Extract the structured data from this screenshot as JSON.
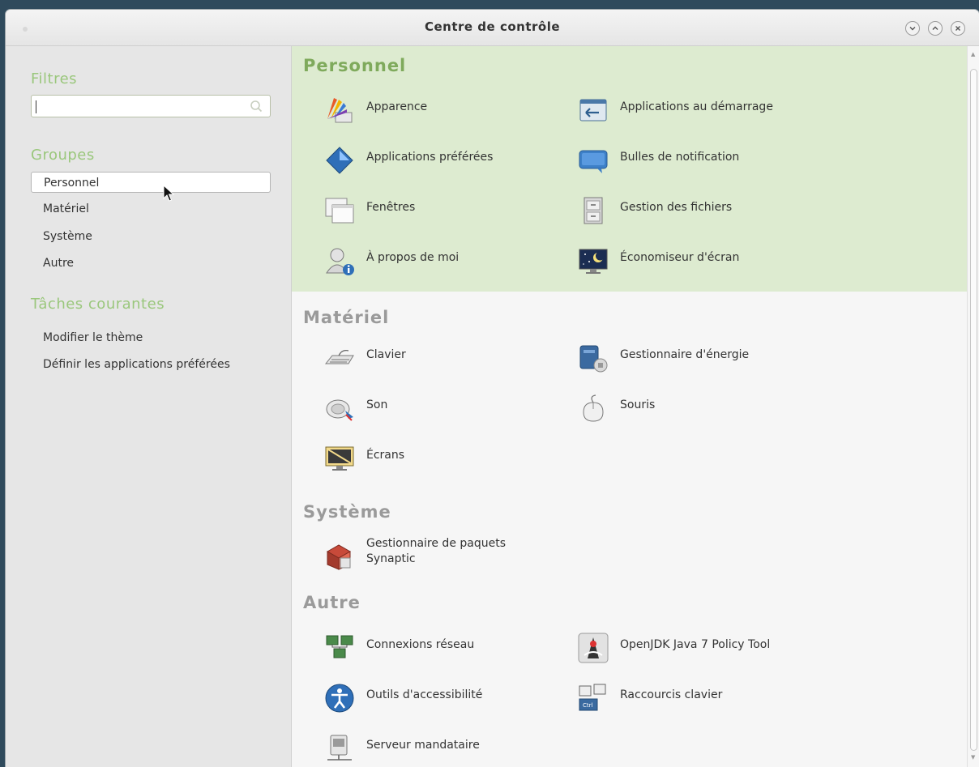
{
  "window": {
    "title": "Centre de contrôle"
  },
  "sidebar": {
    "filters_heading": "Filtres",
    "search": {
      "value": "",
      "placeholder": ""
    },
    "groups_heading": "Groupes",
    "groups": [
      "Personnel",
      "Matériel",
      "Système",
      "Autre"
    ],
    "selected_group": "Personnel",
    "tasks_heading": "Tâches courantes",
    "tasks": [
      "Modifier le thème",
      "Définir les applications préférées"
    ]
  },
  "sections": [
    {
      "title": "Personnel",
      "color": "#7faa5c",
      "items": [
        {
          "label": "Apparence",
          "icon": "appearance-icon"
        },
        {
          "label": "Applications au démarrage",
          "icon": "startup-applications-icon"
        },
        {
          "label": "Applications préférées",
          "icon": "preferred-applications-icon"
        },
        {
          "label": "Bulles de notification",
          "icon": "notification-bubble-icon"
        },
        {
          "label": "Fenêtres",
          "icon": "windows-icon"
        },
        {
          "label": "Gestion des fichiers",
          "icon": "file-management-icon"
        },
        {
          "label": "À propos de moi",
          "icon": "about-me-icon"
        },
        {
          "label": "Économiseur d'écran",
          "icon": "screensaver-icon"
        }
      ]
    },
    {
      "title": "Matériel",
      "color": "#9a9a9a",
      "items": [
        {
          "label": "Clavier",
          "icon": "keyboard-icon"
        },
        {
          "label": "Gestionnaire d'énergie",
          "icon": "power-manager-icon"
        },
        {
          "label": "Son",
          "icon": "sound-icon"
        },
        {
          "label": "Souris",
          "icon": "mouse-icon"
        },
        {
          "label": "Écrans",
          "icon": "displays-icon"
        }
      ]
    },
    {
      "title": "Système",
      "color": "#9a9a9a",
      "items": [
        {
          "label": "Gestionnaire de paquets Synaptic",
          "icon": "package-manager-icon"
        }
      ]
    },
    {
      "title": "Autre",
      "color": "#9a9a9a",
      "items": [
        {
          "label": "Connexions réseau",
          "icon": "network-connections-icon"
        },
        {
          "label": "OpenJDK Java 7 Policy Tool",
          "icon": "java-policy-tool-icon"
        },
        {
          "label": "Outils d'accessibilité",
          "icon": "accessibility-icon"
        },
        {
          "label": "Raccourcis clavier",
          "icon": "keyboard-shortcuts-icon"
        },
        {
          "label": "Serveur mandataire",
          "icon": "proxy-server-icon"
        }
      ]
    }
  ],
  "colors": {
    "sidebar_heading": "#9ac77c",
    "personnel_band": "#ddebd0"
  }
}
